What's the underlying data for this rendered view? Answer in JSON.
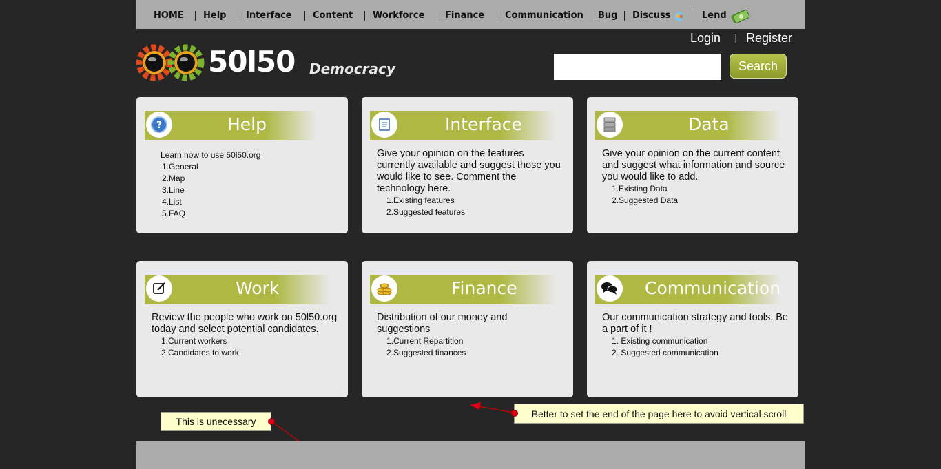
{
  "nav": {
    "items": [
      {
        "label": "HOME"
      },
      {
        "label": "Help"
      },
      {
        "label": "Interface"
      },
      {
        "label": "Content"
      },
      {
        "label": "Workforce"
      },
      {
        "label": "Finance"
      },
      {
        "label": "Communication"
      },
      {
        "label": "Bug"
      },
      {
        "label": "Discuss",
        "icon": "chat-people-icon"
      },
      {
        "label": "Lend",
        "icon": "money-icon"
      }
    ]
  },
  "account": {
    "login": "Login",
    "separator": "|",
    "register": "Register"
  },
  "logo": {
    "number_text": "50l50",
    "tagline": "Democracy"
  },
  "search": {
    "value": "",
    "button": "Search"
  },
  "cards": [
    {
      "title": "Help",
      "icon": "question-icon",
      "intro": "Learn how to use 50l50.org",
      "items": [
        "1.General",
        "2.Map",
        "3.Line",
        "4.List",
        "5.FAQ"
      ]
    },
    {
      "title": "Interface",
      "icon": "document-icon",
      "intro": "Give your opinion on the features currently available and suggest those you would like to see. Comment the technology here.",
      "items": [
        "1.Existing features",
        "2.Suggested features"
      ]
    },
    {
      "title": "Data",
      "icon": "database-icon",
      "intro": "Give your opinion on the current content and suggest what information and source you would like to add.",
      "items": [
        "1.Existing Data",
        "2.Suggested Data"
      ]
    },
    {
      "title": "Work",
      "icon": "edit-icon",
      "intro": "Review the people who work on 50l50.org today and select potential candidates.",
      "items": [
        "1.Current workers",
        "2.Candidates to work"
      ]
    },
    {
      "title": "Finance",
      "icon": "coins-icon",
      "intro": "Distribution of our money and suggestions",
      "items": [
        "1.Current Repartition",
        "2.Suggested finances"
      ]
    },
    {
      "title": "Communication",
      "icon": "speech-bubbles-icon",
      "intro": "Our communication strategy and tools. Be a part of it !",
      "items": [
        "1. Existing communication",
        "2. Suggested communication"
      ]
    }
  ],
  "notes": {
    "unnecessary": "This is unecessary",
    "end_of_page": "Better to set the end of the page here to avoid vertical scroll"
  },
  "colors": {
    "accent": "#aeb843",
    "background": "#262626",
    "bar": "#ababab",
    "note": "#ffffcc"
  }
}
